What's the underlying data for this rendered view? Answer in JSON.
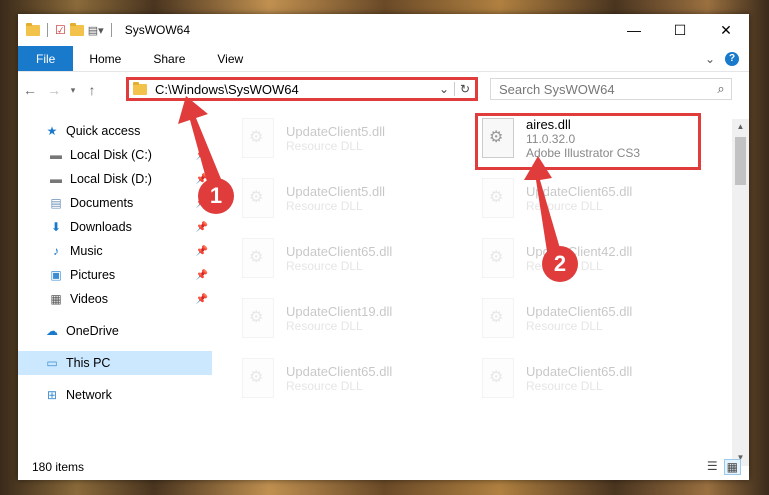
{
  "window": {
    "title": "SysWOW64",
    "controls": {
      "minimize": "—",
      "maximize": "☐",
      "close": "✕"
    }
  },
  "ribbon": {
    "tabs": [
      "File",
      "Home",
      "Share",
      "View"
    ]
  },
  "address": {
    "path": "C:\\Windows\\SysWOW64",
    "search_placeholder": "Search SysWOW64"
  },
  "nav": {
    "items": [
      {
        "label": "Quick access",
        "icon": "star-icon"
      },
      {
        "label": "Local Disk (C:)",
        "icon": "drive-icon"
      },
      {
        "label": "Local Disk (D:)",
        "icon": "drive-icon"
      },
      {
        "label": "Documents",
        "icon": "documents-icon"
      },
      {
        "label": "Downloads",
        "icon": "downloads-icon"
      },
      {
        "label": "Music",
        "icon": "music-icon"
      },
      {
        "label": "Pictures",
        "icon": "pictures-icon"
      },
      {
        "label": "Videos",
        "icon": "videos-icon"
      },
      {
        "label": "OneDrive",
        "icon": "cloud-icon"
      },
      {
        "label": "This PC",
        "icon": "computer-icon"
      },
      {
        "label": "Network",
        "icon": "network-icon"
      }
    ]
  },
  "files": {
    "left": [
      {
        "name": "UpdateClient5.dll",
        "type": "Resource DLL"
      },
      {
        "name": "UpdateClient5.dll",
        "type": "Resource DLL"
      },
      {
        "name": "UpdateClient65.dll",
        "type": "Resource DLL"
      },
      {
        "name": "UpdateClient19.dll",
        "type": "Resource DLL"
      },
      {
        "name": "UpdateClient65.dll",
        "type": "Resource DLL"
      }
    ],
    "right": [
      {
        "name": "aires.dll",
        "version": "11.0.32.0",
        "product": "Adobe Illustrator CS3"
      },
      {
        "name": "UpdateClient65.dll",
        "type": "Resource DLL"
      },
      {
        "name": "UpdateClient42.dll",
        "type": "Resource DLL"
      },
      {
        "name": "UpdateClient65.dll",
        "type": "Resource DLL"
      },
      {
        "name": "UpdateClient65.dll",
        "type": "Resource DLL"
      }
    ]
  },
  "status": {
    "count": "180 items"
  },
  "annotations": {
    "step1": "1",
    "step2": "2"
  },
  "colors": {
    "accent": "#1979ca",
    "highlight": "#e03c3c",
    "selected": "#cce8ff"
  }
}
